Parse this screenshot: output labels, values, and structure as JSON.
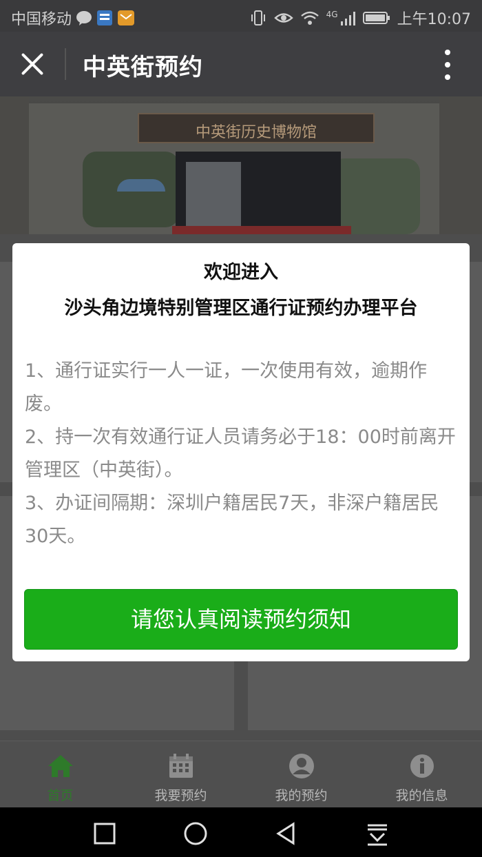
{
  "status_bar": {
    "carrier": "中国移动",
    "network": "4G",
    "time": "上午10:07",
    "icons": [
      "wechat-bubble-icon",
      "app-notification-icon",
      "mail-icon",
      "vibrate-icon",
      "eye-icon",
      "wifi-icon",
      "signal-icon",
      "battery-icon"
    ]
  },
  "title_bar": {
    "title": "中英街预约",
    "close_icon": "close-icon",
    "more_icon": "more-vertical-icon"
  },
  "banner": {
    "sign_text": "中英街历史博物馆"
  },
  "modal": {
    "title_line1": "欢迎进入",
    "title_line2": "沙头角边境特别管理区通行证预约办理平台",
    "rules": [
      "1、通行证实行一人一证，一次使用有效，逾期作废。",
      "2、持一次有效通行证人员请务必于18：00时前离开管理区（中英街）。",
      "3、办证间隔期：深圳户籍居民7天，非深户籍居民30天。"
    ],
    "button_label": "请您认真阅读预约须知",
    "button_color": "#1aad19"
  },
  "tab_bar": {
    "tabs": [
      {
        "label": "首页",
        "icon": "home-icon",
        "active": true
      },
      {
        "label": "我要预约",
        "icon": "calendar-icon",
        "active": false
      },
      {
        "label": "我的预约",
        "icon": "user-circle-icon",
        "active": false
      },
      {
        "label": "我的信息",
        "icon": "info-icon",
        "active": false
      }
    ],
    "active_color": "#2e7a2a"
  },
  "nav_bar": {
    "buttons": [
      "recent-apps-icon",
      "home-circle-icon",
      "back-icon",
      "notification-pull-icon"
    ]
  }
}
